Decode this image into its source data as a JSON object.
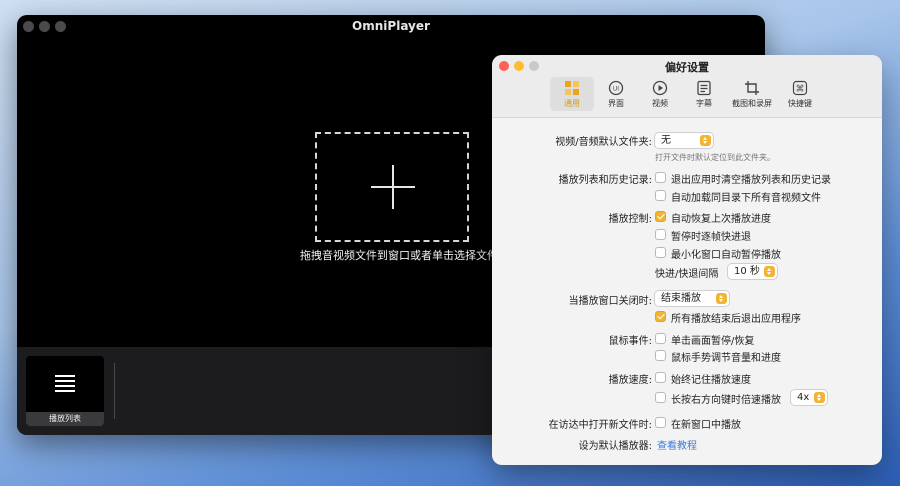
{
  "player": {
    "title": "OmniPlayer",
    "drop_text": "拖拽音视频文件到窗口或者单击选择文件",
    "playlist_label": "播放列表"
  },
  "prefs": {
    "title": "偏好设置",
    "tabs": [
      {
        "label": "通用",
        "icon": "general-grid-icon",
        "active": true
      },
      {
        "label": "界面",
        "icon": "ui-icon",
        "active": false
      },
      {
        "label": "视频",
        "icon": "play-circle-icon",
        "active": false
      },
      {
        "label": "字幕",
        "icon": "subtitle-icon",
        "active": false
      },
      {
        "label": "截图和录屏",
        "icon": "crop-icon",
        "active": false
      },
      {
        "label": "快捷键",
        "icon": "command-icon",
        "active": false
      }
    ],
    "default_folder": {
      "label": "视频/音频默认文件夹:",
      "value": "无",
      "hint": "打开文件时默认定位到此文件夹。"
    },
    "history": {
      "label": "播放列表和历史记录:",
      "options": [
        {
          "text": "退出应用时清空播放列表和历史记录",
          "checked": false
        },
        {
          "text": "自动加载同目录下所有音视频文件",
          "checked": false
        }
      ]
    },
    "playback_control": {
      "label": "播放控制:",
      "options": [
        {
          "text": "自动恢复上次播放进度",
          "checked": true
        },
        {
          "text": "暂停时逐帧快进退",
          "checked": false
        },
        {
          "text": "最小化窗口自动暂停播放",
          "checked": false
        }
      ],
      "seek_label": "快进/快退间隔",
      "seek_value": "10 秒"
    },
    "on_close": {
      "label": "当播放窗口关闭时:",
      "value": "结束播放",
      "option": {
        "text": "所有播放结束后退出应用程序",
        "checked": true
      }
    },
    "mouse": {
      "label": "鼠标事件:",
      "options": [
        {
          "text": "单击画面暂停/恢复",
          "checked": false
        },
        {
          "text": "鼠标手势调节音量和进度",
          "checked": false
        }
      ]
    },
    "speed": {
      "label": "播放速度:",
      "options": [
        {
          "text": "始终记住播放速度",
          "checked": false
        },
        {
          "text": "长按右方向键时倍速播放",
          "checked": false
        }
      ],
      "rate_value": "4x"
    },
    "finder": {
      "label": "在访达中打开新文件时:",
      "option": {
        "text": "在新窗口中播放",
        "checked": false
      }
    },
    "default_player": {
      "label": "设为默认播放器:",
      "link": "查看教程"
    }
  },
  "colors": {
    "accent": "#f1b533",
    "link": "#3b7ad9"
  }
}
